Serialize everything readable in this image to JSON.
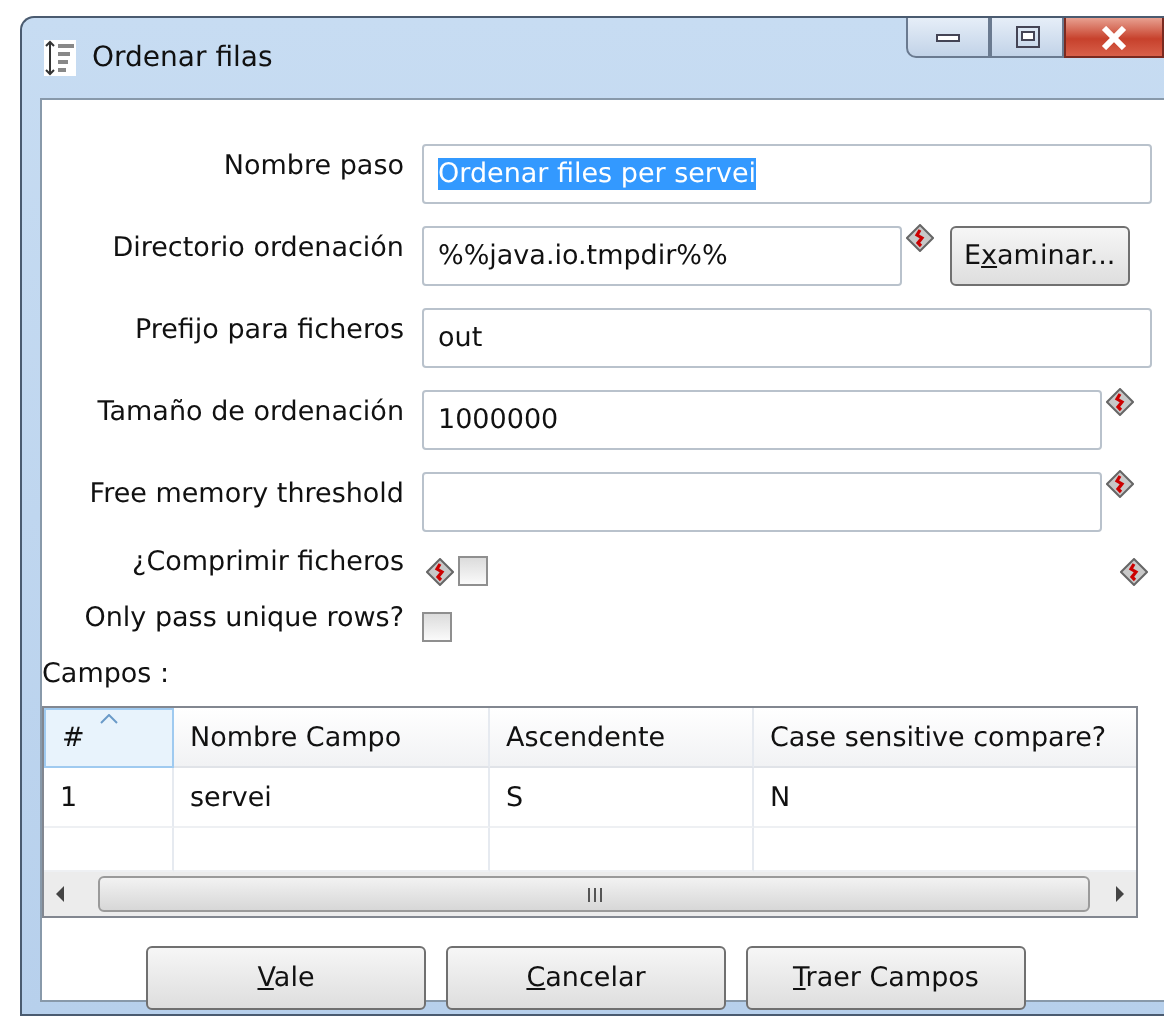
{
  "window": {
    "title": "Ordenar filas"
  },
  "fields": [
    {
      "kind": "text",
      "label": "Nombre paso",
      "value": "Ordenar files per servei",
      "selected": true
    },
    {
      "kind": "text",
      "label": "Directorio ordenación",
      "value": "%%java.io.tmpdir%%",
      "variable": true,
      "button": {
        "before": "E",
        "key": "x",
        "after": "aminar..."
      }
    },
    {
      "kind": "text",
      "label": "Prefijo para ficheros",
      "value": "out"
    },
    {
      "kind": "text",
      "label": "Tamaño de ordenación",
      "value": "1000000",
      "variable": true
    },
    {
      "kind": "text",
      "label": "Free memory threshold",
      "variable": true
    },
    {
      "kind": "checkbox",
      "label": "¿Comprimir ficheros",
      "checked": false,
      "variable": true,
      "variable_right": true
    },
    {
      "kind": "checkbox",
      "label": "Only pass unique rows?",
      "checked": false
    }
  ],
  "fields_table": {
    "title": "Campos :",
    "columns": [
      "#",
      "Nombre Campo",
      "Ascendente",
      "Case sensitive compare?"
    ],
    "rows": [
      [
        "1",
        "servei",
        "S",
        "N"
      ]
    ]
  },
  "buttons": [
    {
      "key": "V",
      "after": "ale"
    },
    {
      "key": "C",
      "after": "ancelar"
    },
    {
      "key": "T",
      "after": "raer Campos"
    }
  ]
}
